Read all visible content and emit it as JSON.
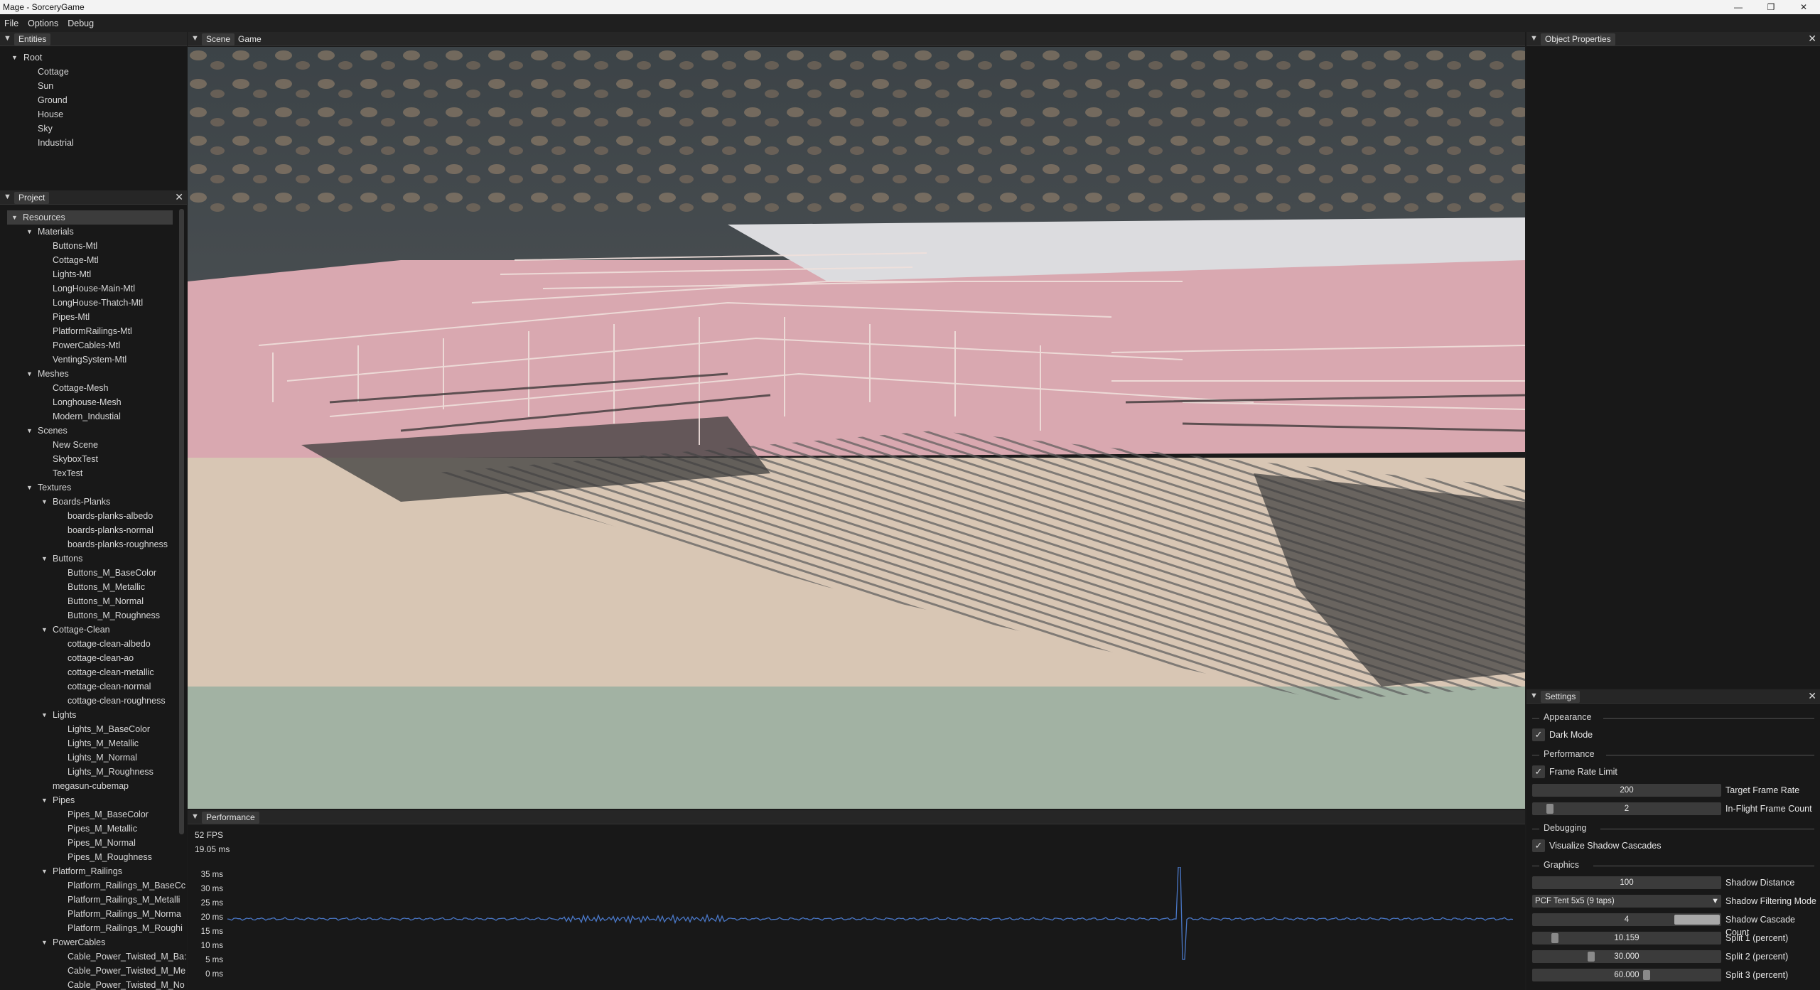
{
  "window": {
    "title": "Mage - SorceryGame"
  },
  "menu": [
    "File",
    "Options",
    "Debug"
  ],
  "entities": {
    "tab": "Entities",
    "root": "Root",
    "children": [
      "Cottage",
      "Sun",
      "Ground",
      "House",
      "Sky",
      "Industrial"
    ]
  },
  "project": {
    "tab": "Project",
    "tree": [
      {
        "label": "Resources",
        "level": 0,
        "folder": true,
        "selected": true
      },
      {
        "label": "Materials",
        "level": 1,
        "folder": true
      },
      {
        "label": "Buttons-Mtl",
        "level": 2
      },
      {
        "label": "Cottage-Mtl",
        "level": 2
      },
      {
        "label": "Lights-Mtl",
        "level": 2
      },
      {
        "label": "LongHouse-Main-Mtl",
        "level": 2
      },
      {
        "label": "LongHouse-Thatch-Mtl",
        "level": 2
      },
      {
        "label": "Pipes-Mtl",
        "level": 2
      },
      {
        "label": "PlatformRailings-Mtl",
        "level": 2
      },
      {
        "label": "PowerCables-Mtl",
        "level": 2
      },
      {
        "label": "VentingSystem-Mtl",
        "level": 2
      },
      {
        "label": "Meshes",
        "level": 1,
        "folder": true
      },
      {
        "label": "Cottage-Mesh",
        "level": 2
      },
      {
        "label": "Longhouse-Mesh",
        "level": 2
      },
      {
        "label": "Modern_Industial",
        "level": 2
      },
      {
        "label": "Scenes",
        "level": 1,
        "folder": true
      },
      {
        "label": "New Scene",
        "level": 2
      },
      {
        "label": "SkyboxTest",
        "level": 2
      },
      {
        "label": "TexTest",
        "level": 2
      },
      {
        "label": "Textures",
        "level": 1,
        "folder": true
      },
      {
        "label": "Boards-Planks",
        "level": 2,
        "folder": true
      },
      {
        "label": "boards-planks-albedo",
        "level": 3
      },
      {
        "label": "boards-planks-normal",
        "level": 3
      },
      {
        "label": "boards-planks-roughness",
        "level": 3
      },
      {
        "label": "Buttons",
        "level": 2,
        "folder": true
      },
      {
        "label": "Buttons_M_BaseColor",
        "level": 3
      },
      {
        "label": "Buttons_M_Metallic",
        "level": 3
      },
      {
        "label": "Buttons_M_Normal",
        "level": 3
      },
      {
        "label": "Buttons_M_Roughness",
        "level": 3
      },
      {
        "label": "Cottage-Clean",
        "level": 2,
        "folder": true
      },
      {
        "label": "cottage-clean-albedo",
        "level": 3
      },
      {
        "label": "cottage-clean-ao",
        "level": 3
      },
      {
        "label": "cottage-clean-metallic",
        "level": 3
      },
      {
        "label": "cottage-clean-normal",
        "level": 3
      },
      {
        "label": "cottage-clean-roughness",
        "level": 3
      },
      {
        "label": "Lights",
        "level": 2,
        "folder": true
      },
      {
        "label": "Lights_M_BaseColor",
        "level": 3
      },
      {
        "label": "Lights_M_Metallic",
        "level": 3
      },
      {
        "label": "Lights_M_Normal",
        "level": 3
      },
      {
        "label": "Lights_M_Roughness",
        "level": 3
      },
      {
        "label": "megasun-cubemap",
        "level": 2
      },
      {
        "label": "Pipes",
        "level": 2,
        "folder": true
      },
      {
        "label": "Pipes_M_BaseColor",
        "level": 3
      },
      {
        "label": "Pipes_M_Metallic",
        "level": 3
      },
      {
        "label": "Pipes_M_Normal",
        "level": 3
      },
      {
        "label": "Pipes_M_Roughness",
        "level": 3
      },
      {
        "label": "Platform_Railings",
        "level": 2,
        "folder": true
      },
      {
        "label": "Platform_Railings_M_BaseCc",
        "level": 3
      },
      {
        "label": "Platform_Railings_M_Metalli",
        "level": 3
      },
      {
        "label": "Platform_Railings_M_Norma",
        "level": 3
      },
      {
        "label": "Platform_Railings_M_Roughi",
        "level": 3
      },
      {
        "label": "PowerCables",
        "level": 2,
        "folder": true
      },
      {
        "label": "Cable_Power_Twisted_M_Ba:",
        "level": 3
      },
      {
        "label": "Cable_Power_Twisted_M_Me",
        "level": 3
      },
      {
        "label": "Cable_Power_Twisted_M_No",
        "level": 3
      }
    ]
  },
  "viewport": {
    "tabs": [
      "Scene",
      "Game"
    ]
  },
  "performance": {
    "tab": "Performance",
    "fps": "52 FPS",
    "frame_time": "19.05 ms",
    "y_labels": [
      "35 ms",
      "30 ms",
      "25 ms",
      "20 ms",
      "15 ms",
      "10 ms",
      "5 ms",
      "0 ms"
    ],
    "line_color": "#4a78c8"
  },
  "object_properties": {
    "tab": "Object Properties"
  },
  "settings": {
    "tab": "Settings",
    "appearance": {
      "header": "Appearance",
      "dark_mode": {
        "label": "Dark Mode",
        "checked": true
      }
    },
    "performance": {
      "header": "Performance",
      "frame_rate_limit": {
        "label": "Frame Rate Limit",
        "checked": true
      },
      "target_frame_rate": {
        "label": "Target Frame Rate",
        "value": "200"
      },
      "in_flight_frame_count": {
        "label": "In-Flight Frame Count",
        "value": "2"
      }
    },
    "debugging": {
      "header": "Debugging",
      "visualize_shadow_cascades": {
        "label": "Visualize Shadow Cascades",
        "checked": true
      }
    },
    "graphics": {
      "header": "Graphics",
      "shadow_distance": {
        "label": "Shadow Distance",
        "value": "100"
      },
      "shadow_filtering_mode": {
        "label": "Shadow Filtering Mode",
        "value": "PCF Tent 5x5 (9 taps)"
      },
      "shadow_cascade_count": {
        "label": "Shadow Cascade Count",
        "value": "4"
      },
      "split1": {
        "label": "Split 1 (percent)",
        "value": "10.159"
      },
      "split2": {
        "label": "Split 2 (percent)",
        "value": "30.000"
      },
      "split3": {
        "label": "Split 3 (percent)",
        "value": "60.000"
      }
    }
  },
  "colors": {
    "panel_bg": "#181818",
    "header_bg": "#262626",
    "sky": "#4a4f52",
    "ground_far": "#d9c7b5",
    "ground_near": "#a3b3a3",
    "pink": "#d9a8b0"
  }
}
